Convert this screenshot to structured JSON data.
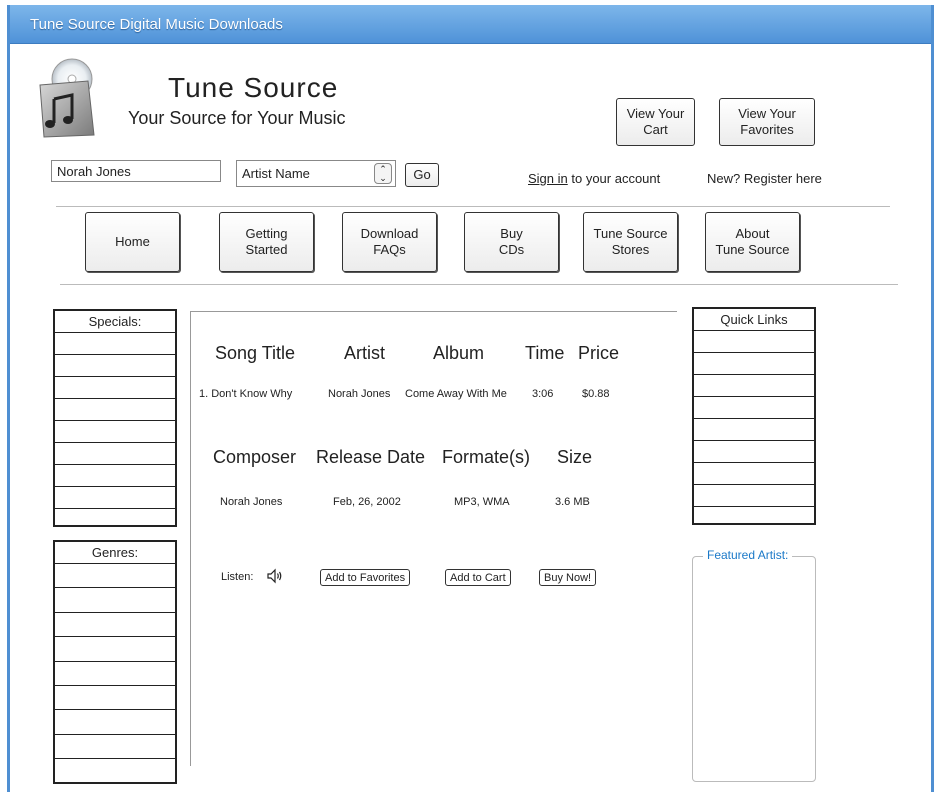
{
  "window": {
    "title": "Tune Source Digital Music Downloads"
  },
  "brand": {
    "title": "Tune Source",
    "subtitle": "Your Source for Your Music",
    "logo_icon": "shopping-bag-music-icon"
  },
  "header_buttons": {
    "cart": "View Your\nCart",
    "favorites": "View Your\nFavorites"
  },
  "search": {
    "query": "Norah Jones",
    "type_selected": "Artist Name",
    "go_label": "Go"
  },
  "account": {
    "sign_in_link": "Sign in",
    "sign_in_suffix": " to your account",
    "register": "New? Register here"
  },
  "nav": [
    "Home",
    "Getting\nStarted",
    "Download\nFAQs",
    "Buy\nCDs",
    "Tune Source\nStores",
    "About\nTune Source"
  ],
  "sidebar_left": {
    "specials_title": "Specials:",
    "specials_rows": 9,
    "genres_title": "Genres:",
    "genres_rows": 9
  },
  "song": {
    "headers": [
      "Song Title",
      "Artist",
      "Album",
      "Time",
      "Price"
    ],
    "values": [
      "1. Don't Know Why",
      "Norah Jones",
      "Come Away With Me",
      "3:06",
      "$0.88"
    ]
  },
  "details": {
    "headers": [
      "Composer",
      "Release Date",
      "Formate(s)",
      "Size"
    ],
    "values": [
      "Norah Jones",
      "Feb, 26, 2002",
      "MP3, WMA",
      "3.6 MB"
    ]
  },
  "actions": {
    "listen_label": "Listen:",
    "speaker_icon": "speaker-icon",
    "add_favorites": "Add to Favorites",
    "add_cart": "Add to Cart",
    "buy_now": "Buy Now!"
  },
  "sidebar_right": {
    "quick_links_title": "Quick Links",
    "quick_links_rows": 9,
    "featured_title": "Featured Artist:"
  },
  "colors": {
    "titlebar": "#4f92d8",
    "featured_legend": "#1b79c8"
  }
}
